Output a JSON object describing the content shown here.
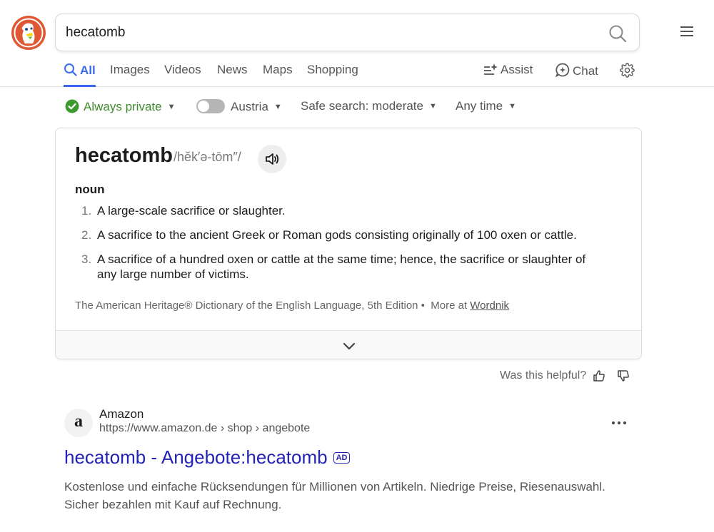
{
  "search": {
    "query": "hecatomb"
  },
  "tabs": [
    {
      "label": "All"
    },
    {
      "label": "Images"
    },
    {
      "label": "Videos"
    },
    {
      "label": "News"
    },
    {
      "label": "Maps"
    },
    {
      "label": "Shopping"
    }
  ],
  "actions": {
    "assist": "Assist",
    "chat": "Chat"
  },
  "filters": {
    "privacy": "Always private",
    "region": "Austria",
    "safe_search": "Safe search: moderate",
    "time": "Any time"
  },
  "definition": {
    "word": "hecatomb",
    "pronunciation": "/hĕk′ə-tōm″/",
    "part_of_speech": "noun",
    "senses": [
      {
        "num": "1.",
        "text": "A large-scale sacrifice or slaughter."
      },
      {
        "num": "2.",
        "text": "A sacrifice to the ancient Greek or Roman gods consisting originally of 100 oxen or cattle."
      },
      {
        "num": "3.",
        "text": "A sacrifice of a hundred oxen or cattle at the same time; hence, the sacrifice or slaughter of any large number of victims."
      }
    ],
    "source": "The American Heritage® Dictionary of the English Language, 5th Edition",
    "more_prefix": "More at",
    "more_link": "Wordnik"
  },
  "feedback": {
    "question": "Was this helpful?"
  },
  "ad_result": {
    "favicon_letter": "a",
    "site_name": "Amazon",
    "url": "https://www.amazon.de › shop › angebote",
    "title": "hecatomb - Angebote:hecatomb",
    "badge": "AD",
    "snippet": "Kostenlose und einfache Rücksendungen für Millionen von Artikeln. Niedrige Preise, Riesenauswahl. Sicher bezahlen mit Kauf auf Rechnung."
  },
  "colors": {
    "accent": "#3969ef",
    "private_green": "#3d8a2a",
    "ad_title": "#2323b6",
    "logo_orange": "#de5833"
  },
  "icons": [
    "duckduckgo-logo-icon",
    "search-icon",
    "hamburger-menu-icon",
    "assist-icon",
    "chat-icon",
    "gear-icon",
    "check-circle-icon",
    "toggle-icon",
    "speaker-icon",
    "chevron-down-icon",
    "thumbs-up-icon",
    "thumbs-down-icon",
    "more-dots-icon"
  ]
}
